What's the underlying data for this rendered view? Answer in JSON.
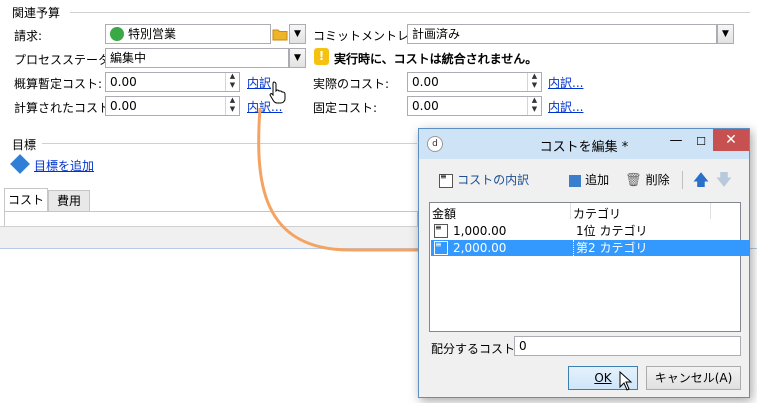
{
  "budget": {
    "section_title": "関連予算",
    "invoice_label": "請求:",
    "invoice_value": "特別営業",
    "commitment_label": "コミットメントレベル:",
    "commitment_value": "計画済み",
    "process_label": "プロセスステータス:",
    "process_value": "編集中",
    "warning_text": "実行時に、コストは統合されません。",
    "estimated_label": "概算暫定コスト:",
    "estimated_value": "0.00",
    "actual_label": "実際のコスト:",
    "actual_value": "0.00",
    "calculated_label": "計算されたコスト:",
    "calculated_value": "0.00",
    "fixed_label": "固定コスト:",
    "fixed_value": "0.00",
    "breakdown_link": "内訳...",
    "breakdown_link_short": "内訳"
  },
  "goals": {
    "section_title": "目標",
    "add_link": "目標を追加"
  },
  "tabs": [
    {
      "label": "コスト"
    },
    {
      "label": "費用"
    }
  ],
  "dialog": {
    "title": "コストを編集 *",
    "toolbar": {
      "breakdown": "コストの内訳",
      "add": "追加",
      "delete": "削除"
    },
    "columns": [
      "金額",
      "カテゴリ"
    ],
    "rows": [
      {
        "amount": "1,000.00",
        "category": "1位 カテゴリ",
        "selected": false
      },
      {
        "amount": "2,000.00",
        "category": "第2 カテゴリ",
        "selected": true
      }
    ],
    "allocate_label": "配分するコスト:",
    "allocate_value": "0",
    "ok_label": "OK",
    "cancel_label": "キャンセル(A)"
  },
  "colors": {
    "link": "#0033cc",
    "selection": "#3399ff",
    "dialog_title": "#cfe3f7",
    "close_button": "#c75050",
    "arrow": "#f4a460",
    "warning": "#f5c211"
  }
}
